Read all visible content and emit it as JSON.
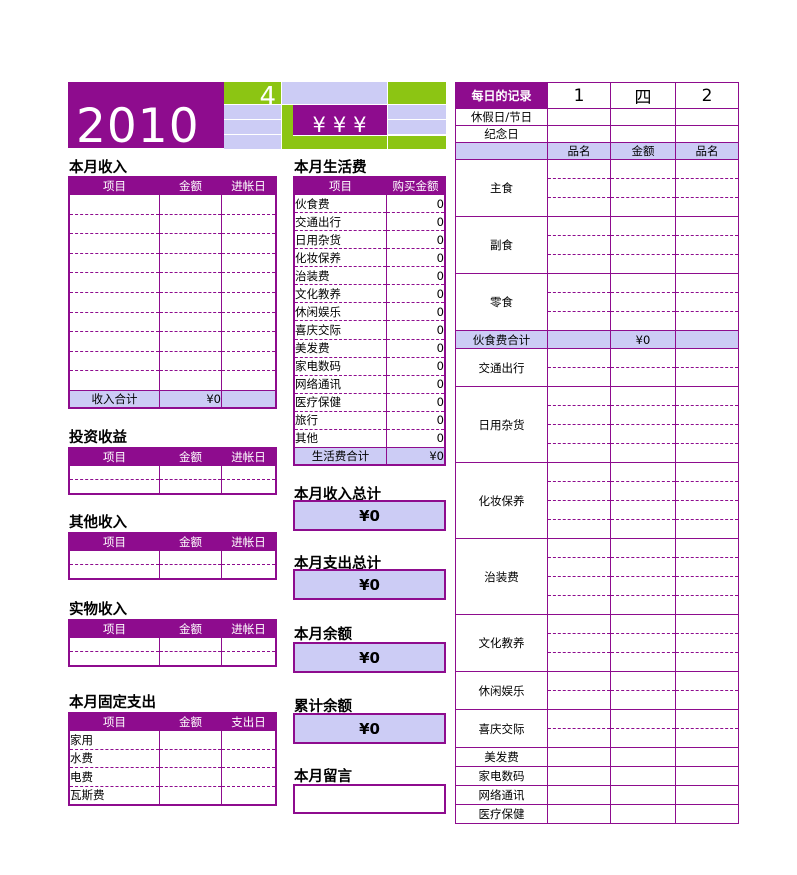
{
  "colors": {
    "purple": "#8E0C8E",
    "green": "#8CC513",
    "lavender": "#CCCCF5",
    "white": "#FFFFFF"
  },
  "header": {
    "year": "2010",
    "month": "4",
    "currency_marks": "¥¥¥"
  },
  "income": {
    "title": "本月收入",
    "columns": [
      "项目",
      "金额",
      "进帐日"
    ],
    "rows": [
      [
        "",
        "",
        ""
      ],
      [
        "",
        "",
        ""
      ],
      [
        "",
        "",
        ""
      ],
      [
        "",
        "",
        ""
      ],
      [
        "",
        "",
        ""
      ],
      [
        "",
        "",
        ""
      ],
      [
        "",
        "",
        ""
      ],
      [
        "",
        "",
        ""
      ],
      [
        "",
        "",
        ""
      ],
      [
        "",
        "",
        ""
      ]
    ],
    "total_label": "收入合计",
    "total_value": "¥0"
  },
  "investment": {
    "title": "投资收益",
    "columns": [
      "项目",
      "金额",
      "进帐日"
    ],
    "rows": [
      [
        "",
        "",
        ""
      ],
      [
        "",
        "",
        ""
      ]
    ]
  },
  "other_income": {
    "title": "其他收入",
    "columns": [
      "项目",
      "金额",
      "进帐日"
    ],
    "rows": [
      [
        "",
        "",
        ""
      ],
      [
        "",
        "",
        ""
      ]
    ]
  },
  "material_income": {
    "title": "实物收入",
    "columns": [
      "项目",
      "金额",
      "进帐日"
    ],
    "rows": [
      [
        "",
        "",
        ""
      ],
      [
        "",
        "",
        ""
      ]
    ]
  },
  "fixed_expense": {
    "title": "本月固定支出",
    "columns": [
      "项目",
      "金额",
      "支出日"
    ],
    "rows": [
      [
        "家用",
        "",
        ""
      ],
      [
        "水费",
        "",
        ""
      ],
      [
        "电费",
        "",
        ""
      ],
      [
        "瓦斯费",
        "",
        ""
      ]
    ]
  },
  "living_expense": {
    "title": "本月生活费",
    "columns": [
      "项目",
      "购买金额"
    ],
    "rows": [
      [
        "伙食费",
        "0"
      ],
      [
        "交通出行",
        "0"
      ],
      [
        "日用杂货",
        "0"
      ],
      [
        "化妆保养",
        "0"
      ],
      [
        "治装费",
        "0"
      ],
      [
        "文化教养",
        "0"
      ],
      [
        "休闲娱乐",
        "0"
      ],
      [
        "喜庆交际",
        "0"
      ],
      [
        "美发费",
        "0"
      ],
      [
        "家电数码",
        "0"
      ],
      [
        "网络通讯",
        "0"
      ],
      [
        "医疗保健",
        "0"
      ],
      [
        "旅行",
        "0"
      ],
      [
        "其他",
        "0"
      ]
    ],
    "total_label": "生活费合计",
    "total_value": "¥0"
  },
  "summary": {
    "income_total": {
      "label": "本月收入总计",
      "value": "¥0"
    },
    "expense_total": {
      "label": "本月支出总计",
      "value": "¥0"
    },
    "month_balance": {
      "label": "本月余额",
      "value": "¥0"
    },
    "cumulative_balance": {
      "label": "累计余额",
      "value": "¥0"
    },
    "memo": {
      "label": "本月留言",
      "value": ""
    }
  },
  "daily": {
    "title": "每日的记录",
    "day_numbers": [
      "1",
      "四",
      "2"
    ],
    "holiday_label": "休假日/节日",
    "anniversary_label": "纪念日",
    "sub_columns": [
      "品名",
      "金额",
      "品名"
    ],
    "categories": [
      {
        "name": "主食",
        "lines": 3
      },
      {
        "name": "副食",
        "lines": 3
      },
      {
        "name": "零食",
        "lines": 3
      }
    ],
    "food_total_label": "伙食费合计",
    "food_total_value": "¥0",
    "sections": [
      {
        "name": "交通出行",
        "lines": 2
      },
      {
        "name": "日用杂货",
        "lines": 4
      },
      {
        "name": "化妆保养",
        "lines": 4
      },
      {
        "name": "治装费",
        "lines": 4
      },
      {
        "name": "文化教养",
        "lines": 3
      },
      {
        "name": "休闲娱乐",
        "lines": 2
      },
      {
        "name": "喜庆交际",
        "lines": 2
      },
      {
        "name": "美发费",
        "lines": 1
      },
      {
        "name": "家电数码",
        "lines": 1
      },
      {
        "name": "网络通讯",
        "lines": 1
      },
      {
        "name": "医疗保健",
        "lines": 1
      }
    ]
  }
}
